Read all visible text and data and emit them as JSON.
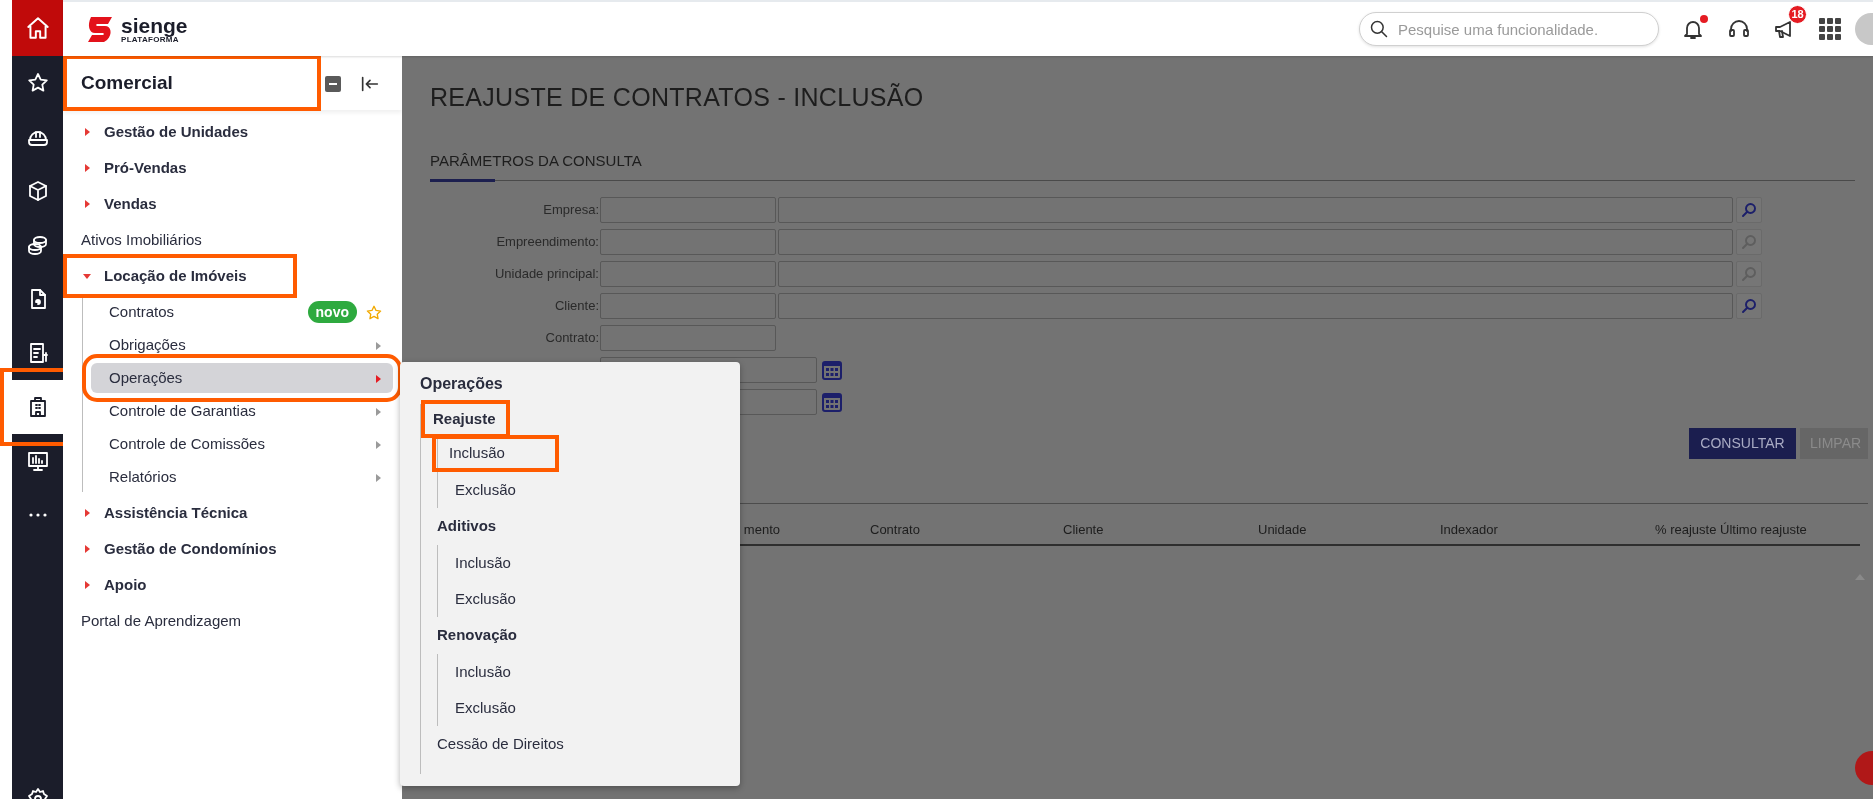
{
  "topbar": {
    "logo": {
      "name": "sienge",
      "tagline": "PLATAFORMA"
    },
    "search": {
      "placeholder": "Pesquise uma funcionalidade."
    },
    "notifications": {
      "unread": true
    },
    "announcements": {
      "count": "18"
    }
  },
  "rail": {
    "home": {
      "selected": true
    },
    "items": [
      {
        "selected": false,
        "highlighted": false
      },
      {
        "selected": false,
        "highlighted": false
      },
      {
        "selected": false,
        "highlighted": false
      },
      {
        "selected": false,
        "highlighted": false
      },
      {
        "selected": false,
        "highlighted": false
      },
      {
        "selected": false,
        "highlighted": false
      },
      {
        "selected": true,
        "highlighted": true
      },
      {
        "selected": false,
        "highlighted": false
      },
      {
        "selected": false,
        "highlighted": false
      },
      {
        "selected": false,
        "highlighted": false
      }
    ]
  },
  "sidebar": {
    "title": "Comercial",
    "title_highlighted": true,
    "items": [
      {
        "kind": "group",
        "label": "Gestão de Unidades",
        "expanded": false,
        "highlighted": false
      },
      {
        "kind": "group",
        "label": "Pró-Vendas",
        "expanded": false,
        "highlighted": false
      },
      {
        "kind": "group",
        "label": "Vendas",
        "expanded": false,
        "highlighted": false
      },
      {
        "kind": "link",
        "label": "Ativos Imobiliários"
      },
      {
        "kind": "group",
        "label": "Locação de Imóveis",
        "expanded": true,
        "highlighted": true,
        "children": [
          {
            "label": "Contratos",
            "badge": "novo",
            "favorite": true,
            "has_submenu": false,
            "selected": false,
            "highlighted": false
          },
          {
            "label": "Obrigações",
            "has_submenu": true,
            "selected": false,
            "highlighted": false
          },
          {
            "label": "Operações",
            "has_submenu": true,
            "selected": true,
            "highlighted": true
          },
          {
            "label": "Controle de Garantias",
            "has_submenu": true,
            "selected": false,
            "highlighted": false
          },
          {
            "label": "Controle de Comissões",
            "has_submenu": true,
            "selected": false,
            "highlighted": false
          },
          {
            "label": "Relatórios",
            "has_submenu": true,
            "selected": false,
            "highlighted": false
          }
        ]
      },
      {
        "kind": "group",
        "label": "Assistência Técnica",
        "expanded": false,
        "highlighted": false
      },
      {
        "kind": "group",
        "label": "Gestão de Condomínios",
        "expanded": false,
        "highlighted": false
      },
      {
        "kind": "group",
        "label": "Apoio",
        "expanded": false,
        "highlighted": false
      },
      {
        "kind": "link",
        "label": "Portal de Aprendizagem"
      }
    ]
  },
  "submenu": {
    "title": "Operações",
    "items": [
      {
        "kind": "group",
        "label": "Reajuste",
        "highlighted": true,
        "children": [
          {
            "label": "Inclusão",
            "highlighted": true
          },
          {
            "label": "Exclusão",
            "highlighted": false
          }
        ]
      },
      {
        "kind": "group",
        "label": "Aditivos",
        "highlighted": false,
        "children": [
          {
            "label": "Inclusão",
            "highlighted": false
          },
          {
            "label": "Exclusão",
            "highlighted": false
          }
        ]
      },
      {
        "kind": "group",
        "label": "Renovação",
        "highlighted": false,
        "children": [
          {
            "label": "Inclusão",
            "highlighted": false
          },
          {
            "label": "Exclusão",
            "highlighted": false
          }
        ]
      },
      {
        "kind": "link",
        "label": "Cessão de Direitos"
      }
    ]
  },
  "page": {
    "title": "REAJUSTE DE CONTRATOS - INCLUSÃO",
    "tabs": [
      {
        "label": "PARÂMETROS DA CONSULTA",
        "selected": true
      }
    ],
    "form": [
      {
        "kind": "lookup",
        "label": "Empresa:",
        "lookup_enabled": true
      },
      {
        "kind": "lookup",
        "label": "Empreendimento:",
        "lookup_enabled": false
      },
      {
        "kind": "lookup",
        "label": "Unidade principal:",
        "lookup_enabled": false
      },
      {
        "kind": "lookup",
        "label": "Cliente:",
        "lookup_enabled": true
      },
      {
        "kind": "text",
        "label": "Contrato:"
      },
      {
        "kind": "date"
      },
      {
        "kind": "date"
      }
    ],
    "buttons": [
      {
        "label": "CONSULTAR",
        "disabled": false
      },
      {
        "label": "LIMPAR",
        "disabled": true
      }
    ],
    "table": {
      "columns": [
        "mento",
        "Contrato",
        "Cliente",
        "Unidade",
        "Indexador",
        "% reajuste Último reajuste"
      ]
    }
  }
}
